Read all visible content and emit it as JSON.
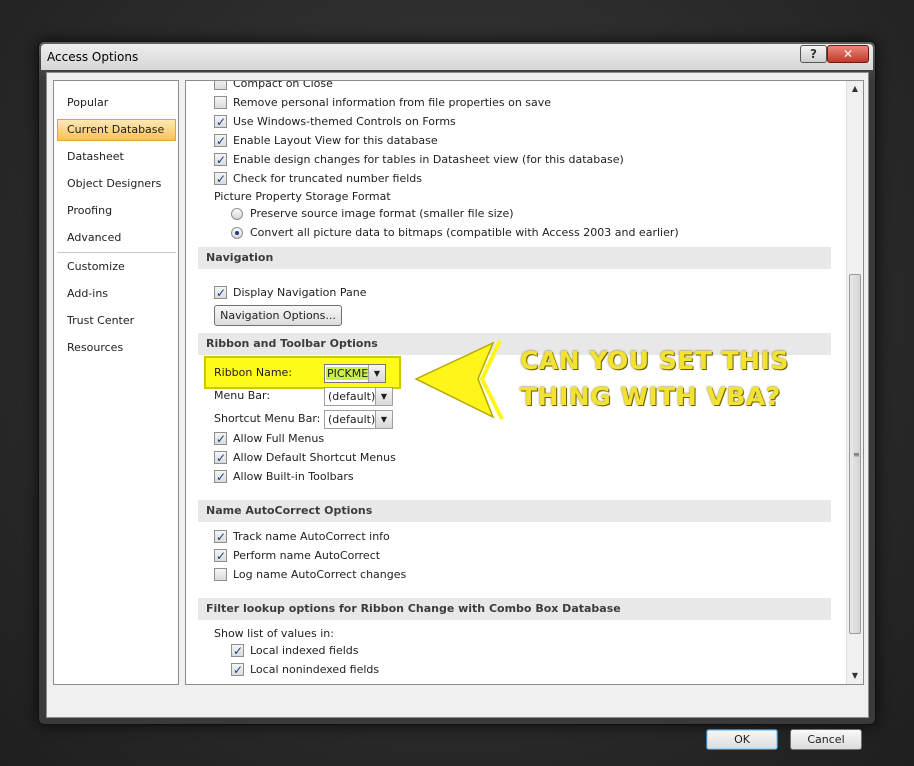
{
  "window": {
    "title": "Access Options",
    "help_label": "?",
    "close_label": "✕"
  },
  "sidebar": {
    "items": [
      {
        "label": "Popular"
      },
      {
        "label": "Current Database"
      },
      {
        "label": "Datasheet"
      },
      {
        "label": "Object Designers"
      },
      {
        "label": "Proofing"
      },
      {
        "label": "Advanced"
      },
      {
        "label": "Customize"
      },
      {
        "label": "Add-ins"
      },
      {
        "label": "Trust Center"
      },
      {
        "label": "Resources"
      }
    ],
    "active": "Current Database"
  },
  "app_options": {
    "compact_on_close": "Compact on Close",
    "remove_personal_info": "Remove personal information from file properties on save",
    "windows_themed_controls": "Use Windows-themed Controls on Forms",
    "enable_layout_view": "Enable Layout View for this database",
    "enable_design_changes": "Enable design changes for tables in Datasheet view (for this database)",
    "check_truncated": "Check for truncated number fields",
    "picture_storage_label": "Picture Property Storage Format",
    "preserve_source": "Preserve source image format (smaller file size)",
    "convert_bitmaps": "Convert all picture data to bitmaps (compatible with Access 2003 and earlier)"
  },
  "navigation": {
    "header": "Navigation",
    "display_pane": "Display Navigation Pane",
    "options_button": "Navigation Options..."
  },
  "ribbon": {
    "header": "Ribbon and Toolbar Options",
    "ribbon_name_label": "Ribbon Name:",
    "ribbon_name_value": "PICKME",
    "menu_bar_label": "Menu Bar:",
    "menu_bar_value": "(default)",
    "shortcut_menu_bar_label": "Shortcut Menu Bar:",
    "shortcut_menu_bar_value": "(default)",
    "allow_full_menus": "Allow Full Menus",
    "allow_default_shortcut": "Allow Default Shortcut Menus",
    "allow_builtin_toolbars": "Allow Built-in Toolbars"
  },
  "autocorrect": {
    "header": "Name AutoCorrect Options",
    "track": "Track name AutoCorrect info",
    "perform": "Perform name AutoCorrect",
    "log": "Log name AutoCorrect changes"
  },
  "filter": {
    "header": "Filter lookup options for Ribbon Change with Combo Box Database",
    "show_list_label": "Show list of values in:",
    "local_indexed": "Local indexed fields",
    "local_nonindexed": "Local nonindexed fields"
  },
  "annotation": {
    "line1": "CAN YOU SET THIS",
    "line2": "THING WITH VBA?",
    "color": "#f2e332"
  },
  "footer": {
    "ok_label": "OK",
    "cancel_label": "Cancel"
  }
}
